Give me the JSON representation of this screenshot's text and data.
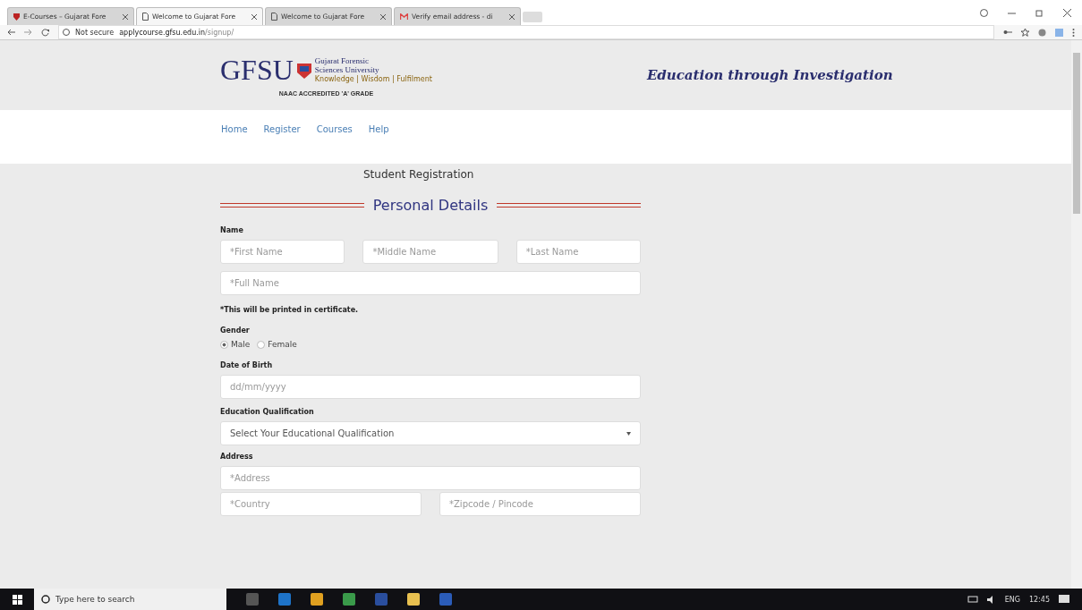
{
  "browser": {
    "tabs": [
      {
        "title": "E-Courses – Gujarat Fore",
        "selected": false,
        "kind": "shield"
      },
      {
        "title": "Welcome to Gujarat Fore",
        "selected": true,
        "kind": "page"
      },
      {
        "title": "Welcome to Gujarat Fore",
        "selected": false,
        "kind": "page"
      },
      {
        "title": "Verify email address - di",
        "selected": false,
        "kind": "mail"
      }
    ],
    "security": "Not secure",
    "url_host": "applycourse.gfsu.edu.in",
    "url_path": "/signup/"
  },
  "header": {
    "logo_text": "GFSU",
    "university_line1": "Gujarat Forensic",
    "university_line2": "Sciences University",
    "motto": "Knowledge | Wisdom | Fulfilment",
    "accreditation": "NAAC ACCREDITED 'A' GRADE",
    "tagline": "Education through Investigation"
  },
  "nav": [
    "Home",
    "Register",
    "Courses",
    "Help"
  ],
  "page_title": "Student Registration",
  "section_title": "Personal Details",
  "form": {
    "name_label": "Name",
    "first_name": "*First Name",
    "middle_name": "*Middle Name",
    "last_name": "*Last Name",
    "full_name": "*Full Name",
    "note": "*This will be printed in certificate.",
    "gender_label": "Gender",
    "genders": [
      {
        "label": "Male",
        "selected": true
      },
      {
        "label": "Female",
        "selected": false
      }
    ],
    "dob_label": "Date of Birth",
    "dob": "dd/mm/yyyy",
    "education_label": "Education Qualification",
    "education": "Select Your Educational Qualification",
    "address_label": "Address",
    "address": "*Address",
    "country": "*Country",
    "zipcode": "*Zipcode / Pincode"
  },
  "taskbar": {
    "search": "Type here to search",
    "language": "ENG",
    "time": "12:45"
  }
}
